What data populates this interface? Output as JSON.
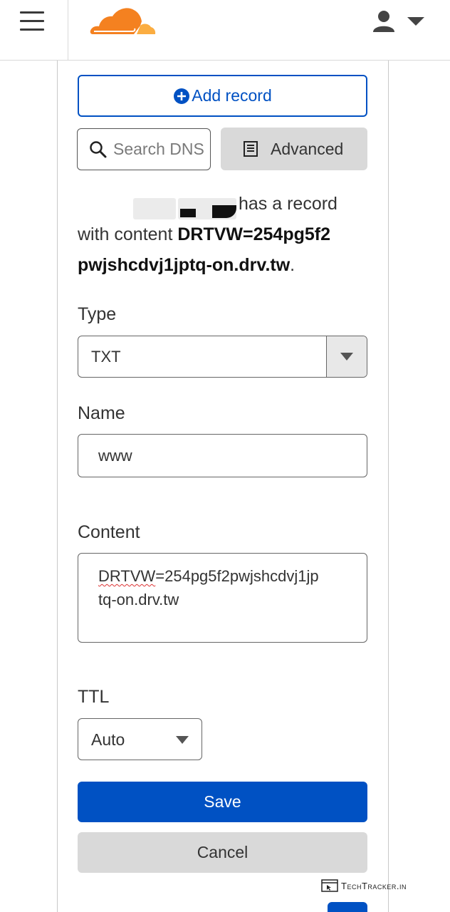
{
  "header": {
    "menu_icon": "hamburger-menu-icon",
    "logo_icon": "cloudflare-logo",
    "user_icon": "user-avatar-icon",
    "dropdown_icon": "caret-down-icon",
    "brand_color": "#f48120",
    "brand_color_light": "#fbad41"
  },
  "toolbar": {
    "add_record_label": "Add record",
    "add_icon": "plus-circle-icon",
    "search_placeholder": "Search DNS",
    "search_icon": "search-icon",
    "advanced_label": "Advanced",
    "advanced_icon": "document-list-icon"
  },
  "description": {
    "line1": "has a record",
    "prefix": "with content ",
    "content_part1": "DRTVW=254pg5f2",
    "content_part2": "pwjshcdvj1jptq-on.drv.tw",
    "suffix": "."
  },
  "form": {
    "type_label": "Type",
    "type_value": "TXT",
    "name_label": "Name",
    "name_value": "www",
    "content_label": "Content",
    "content_value_part1": "DRTVW",
    "content_value_part2": "=254pg5f2pwjshcdvj1jp",
    "content_value_line2": "tq-on.drv.tw",
    "ttl_label": "TTL",
    "ttl_value": "Auto",
    "save_label": "Save",
    "cancel_label": "Cancel"
  },
  "colors": {
    "primary": "#0051c3",
    "secondary_button": "#d9d9d9"
  },
  "watermark": {
    "text": "TechTracker.in",
    "icon": "browser-cursor-icon"
  }
}
